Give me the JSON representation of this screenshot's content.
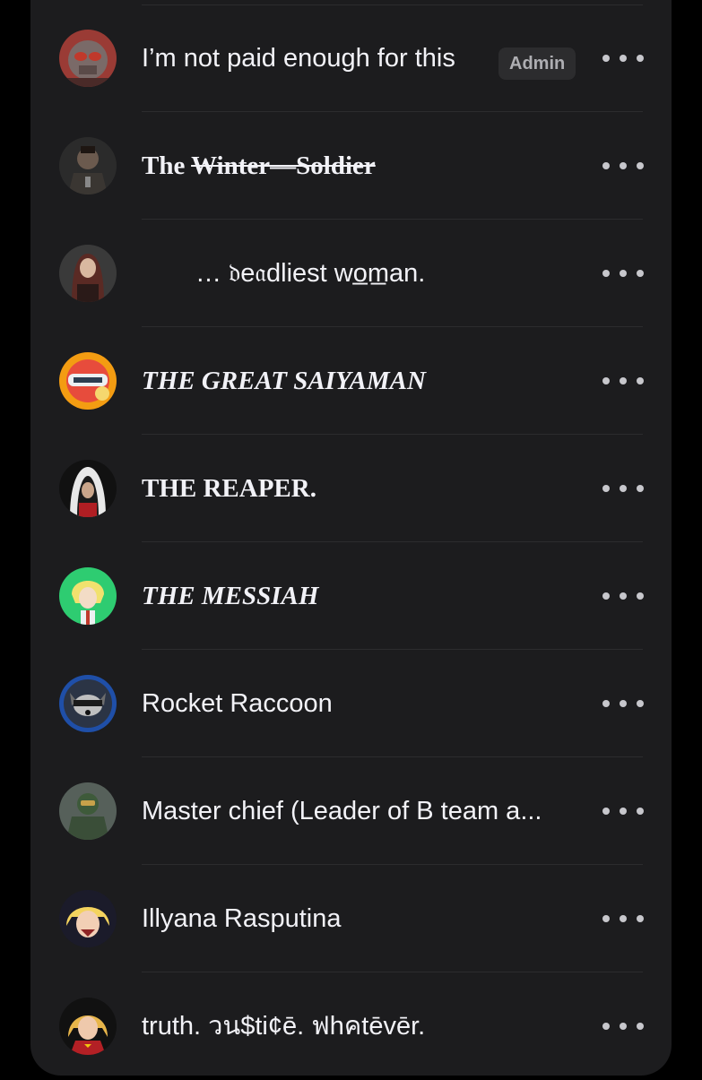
{
  "members": [
    {
      "name": "I’m not paid enough for this",
      "badge": "Admin",
      "avatar_icon": "star-lord-avatar"
    },
    {
      "name_prefix": "The ",
      "name_struck": "Winter—Soldier",
      "avatar_icon": "winter-soldier-avatar"
    },
    {
      "name": "…    𝔡e𝔞dliest   wo̲m̲an.",
      "avatar_icon": "black-widow-avatar"
    },
    {
      "name": "THE GREAT SAIYAMAN",
      "avatar_icon": "great-saiyaman-avatar"
    },
    {
      "name": "THE REAPER.",
      "avatar_icon": "reaper-avatar"
    },
    {
      "name": "THE MESSIAH",
      "avatar_icon": "messiah-avatar"
    },
    {
      "name": "Rocket Raccoon",
      "avatar_icon": "rocket-raccoon-avatar"
    },
    {
      "name": "Master chief (Leader of B team a...",
      "avatar_icon": "master-chief-avatar"
    },
    {
      "name": "Illyana Rasputina",
      "avatar_icon": "illyana-avatar"
    },
    {
      "name": "truth. วน$ti¢ē. ฟhคtēvēr.",
      "avatar_icon": "captain-marvel-avatar"
    }
  ],
  "colors": {
    "background": "#000000",
    "card": "#1c1c1e",
    "divider": "#2c2c2e",
    "text": "#f2f2f7",
    "badge_bg": "#2c2c2e",
    "badge_text": "#aeaeb2"
  }
}
